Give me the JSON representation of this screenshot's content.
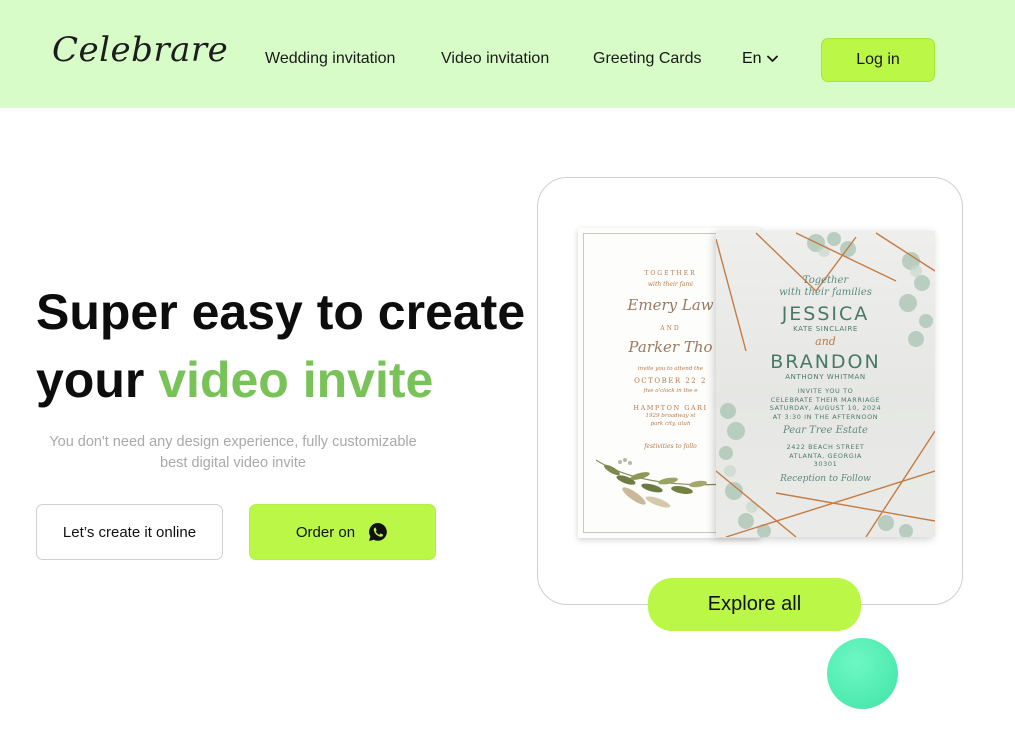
{
  "header": {
    "logo": "Celebrare",
    "nav": [
      {
        "label": "Wedding invitation"
      },
      {
        "label": "Video invitation"
      },
      {
        "label": "Greeting Cards"
      }
    ],
    "language": "En",
    "login_label": "Log in"
  },
  "hero": {
    "title_line1": "Super easy to create",
    "title_line2_plain": "your ",
    "title_line2_accent": "video invite",
    "subtitle": "You don't need any design experience, fully customizable best digital video invite",
    "create_button": "Let’s create it online",
    "order_button": "Order on",
    "order_icon": "whatsapp-icon"
  },
  "showcase": {
    "explore_label": "Explore all",
    "back_card": {
      "lines": [
        "TOGETHER",
        "with their fami",
        "Emery Law",
        "AND",
        "Parker Tho",
        "invite you to attend the",
        "OCTOBER 22 2",
        "five o'clock in the e",
        "HAMPTON GARI",
        "1929 broadway st",
        "park city, utah",
        "festivities to follo"
      ]
    },
    "front_card": {
      "intro": "Together\nwith their families",
      "name1": "JESSICA",
      "name1_full": "KATE SINCLAIRE",
      "and": "and",
      "name2": "BRANDON",
      "name2_full": "ANTHONY WHITMAN",
      "details": "INVITE YOU TO\nCELEBRATE THEIR MARRIAGE\nSATURDAY, AUGUST 10, 2024\nAT 3:30 IN THE AFTERNOON",
      "venue": "Pear Tree Estate",
      "address": "2422 BEACH STREET\nATLANTA, GEORGIA\n30301",
      "reception": "Reception to Follow"
    }
  },
  "colors": {
    "header_bg": "#d8fcc8",
    "accent_green": "#baf747",
    "title_accent": "#78c257",
    "bubble": "#52ecb3"
  }
}
